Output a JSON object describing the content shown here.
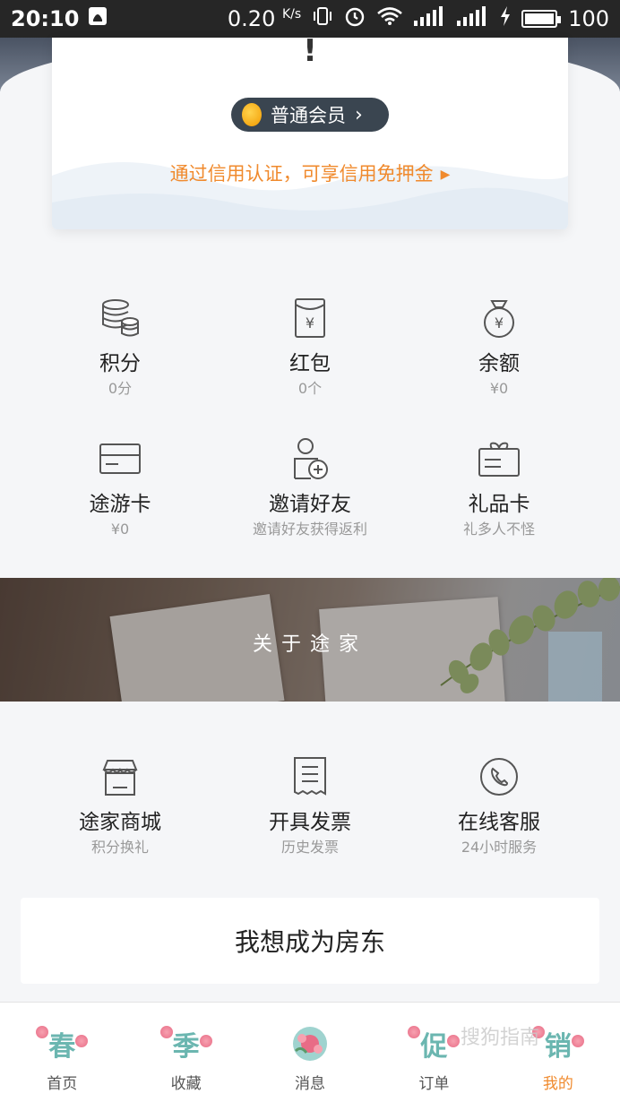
{
  "status_bar": {
    "time": "20:10",
    "network_speed": "0.20",
    "network_unit": "K/s",
    "battery": "100",
    "battery_level": 1.0
  },
  "card": {
    "exclaim": "!",
    "member_label": "普通会员",
    "credit_link": "通过信用认证，可享信用免押金"
  },
  "wallet": [
    {
      "label": "积分",
      "sub": "0分",
      "icon": "coins-icon"
    },
    {
      "label": "红包",
      "sub": "0个",
      "icon": "red-envelope-icon"
    },
    {
      "label": "余额",
      "sub": "¥0",
      "icon": "money-bag-icon"
    }
  ],
  "services": [
    {
      "label": "途游卡",
      "sub": "¥0",
      "icon": "card-icon"
    },
    {
      "label": "邀请好友",
      "sub": "邀请好友获得返利",
      "icon": "invite-friend-icon"
    },
    {
      "label": "礼品卡",
      "sub": "礼多人不怪",
      "icon": "gift-card-icon"
    }
  ],
  "about": {
    "title": "关于途家"
  },
  "tools": [
    {
      "label": "途家商城",
      "sub": "积分换礼",
      "icon": "store-icon"
    },
    {
      "label": "开具发票",
      "sub": "历史发票",
      "icon": "receipt-icon"
    },
    {
      "label": "在线客服",
      "sub": "24小时服务",
      "icon": "phone-icon"
    }
  ],
  "landlord_button": "我想成为房东",
  "tabbar": [
    {
      "glyph": "春",
      "label": "首页",
      "active": false
    },
    {
      "glyph": "季",
      "label": "收藏",
      "active": false
    },
    {
      "glyph": "",
      "label": "消息",
      "active": false
    },
    {
      "glyph": "促",
      "label": "订单",
      "active": false
    },
    {
      "glyph": "销",
      "label": "我的",
      "active": true
    }
  ],
  "watermark": "搜狗指南",
  "colors": {
    "accent": "#f08a2d",
    "dark_pill": "#3a4550",
    "tab_glyph": "#6bb6b0"
  }
}
